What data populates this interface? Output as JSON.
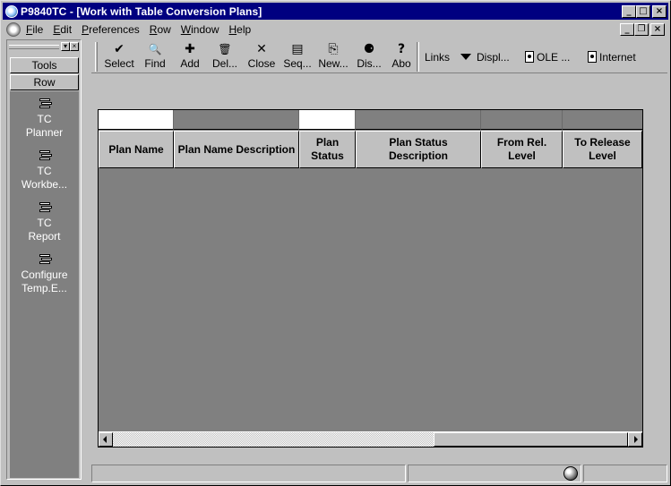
{
  "window": {
    "title": "P9840TC - [Work with Table Conversion Plans]",
    "caption_min": "_",
    "caption_max": "□",
    "caption_close": "×",
    "mdi_min": "_",
    "mdi_restore": "❐",
    "mdi_close": "×"
  },
  "menubar": {
    "items": [
      {
        "label": "File",
        "underline": "F",
        "rest": "ile"
      },
      {
        "label": "Edit",
        "underline": "E",
        "rest": "dit"
      },
      {
        "label": "Preferences",
        "underline": "P",
        "rest": "references"
      },
      {
        "label": "Row",
        "underline": "R",
        "rest": "ow"
      },
      {
        "label": "Window",
        "underline": "W",
        "rest": "indow"
      },
      {
        "label": "Help",
        "underline": "H",
        "rest": "elp"
      }
    ]
  },
  "left_panel": {
    "tabs": [
      "Tools",
      "Row"
    ],
    "items": [
      {
        "line1": "TC",
        "line2": "Planner"
      },
      {
        "line1": "TC",
        "line2": "Workbe..."
      },
      {
        "line1": "TC",
        "line2": "Report"
      },
      {
        "line1": "Configure",
        "line2": "Temp.E..."
      }
    ]
  },
  "toolbar": {
    "buttons": [
      {
        "icon": "✔",
        "label": "Select",
        "name": "select"
      },
      {
        "icon": "🔍",
        "label": "Find",
        "name": "find"
      },
      {
        "icon": "✚",
        "label": "Add",
        "name": "add"
      },
      {
        "icon": "🗑",
        "label": "Del...",
        "name": "delete"
      },
      {
        "icon": "✕",
        "label": "Close",
        "name": "close"
      },
      {
        "icon": "▤",
        "label": "Seq...",
        "name": "sequence"
      },
      {
        "icon": "⎘",
        "label": "New...",
        "name": "new"
      },
      {
        "icon": "⚈",
        "label": "Dis...",
        "name": "display"
      },
      {
        "icon": "?",
        "label": "Abo",
        "name": "about"
      }
    ],
    "links_label": "Links",
    "display_label": "Displ...",
    "ole_label": "OLE ...",
    "internet_label": "Internet"
  },
  "grid": {
    "columns": [
      {
        "label": "Plan Name"
      },
      {
        "label": "Plan Name Description"
      },
      {
        "label": "Plan Status"
      },
      {
        "label": "Plan Status Description"
      },
      {
        "label": "From Rel. Level"
      },
      {
        "label": "To Release Level"
      }
    ],
    "rows": []
  },
  "colors": {
    "title_bar": "#000080",
    "chrome": "#c0c0c0",
    "grid_bg": "#808080"
  }
}
